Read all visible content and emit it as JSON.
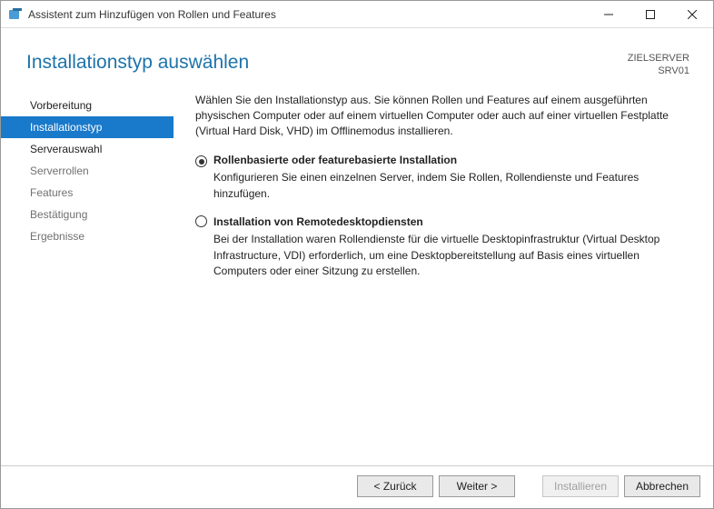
{
  "window": {
    "title": "Assistent zum Hinzufügen von Rollen und Features"
  },
  "header": {
    "page_title": "Installationstyp auswählen",
    "target_label": "ZIELSERVER",
    "target_value": "SRV01"
  },
  "sidebar": {
    "steps": [
      {
        "label": "Vorbereitung",
        "enabled": true,
        "active": false
      },
      {
        "label": "Installationstyp",
        "enabled": true,
        "active": true
      },
      {
        "label": "Serverauswahl",
        "enabled": true,
        "active": false
      },
      {
        "label": "Serverrollen",
        "enabled": false,
        "active": false
      },
      {
        "label": "Features",
        "enabled": false,
        "active": false
      },
      {
        "label": "Bestätigung",
        "enabled": false,
        "active": false
      },
      {
        "label": "Ergebnisse",
        "enabled": false,
        "active": false
      }
    ]
  },
  "content": {
    "intro": "Wählen Sie den Installationstyp aus. Sie können Rollen und Features auf einem ausgeführten physischen Computer oder auf einem virtuellen Computer oder auch auf einer virtuellen Festplatte (Virtual Hard Disk, VHD) im Offlinemodus installieren.",
    "options": [
      {
        "title": "Rollenbasierte oder featurebasierte Installation",
        "desc": "Konfigurieren Sie einen einzelnen Server, indem Sie Rollen, Rollendienste und Features hinzufügen.",
        "checked": true
      },
      {
        "title": "Installation von Remotedesktopdiensten",
        "desc": "Bei der Installation waren Rollendienste für die virtuelle Desktopinfrastruktur (Virtual Desktop Infrastructure, VDI) erforderlich, um eine Desktopbereitstellung auf Basis eines virtuellen Computers oder einer Sitzung zu erstellen.",
        "checked": false
      }
    ]
  },
  "footer": {
    "back": "< Zurück",
    "next": "Weiter >",
    "install": "Installieren",
    "cancel": "Abbrechen"
  }
}
